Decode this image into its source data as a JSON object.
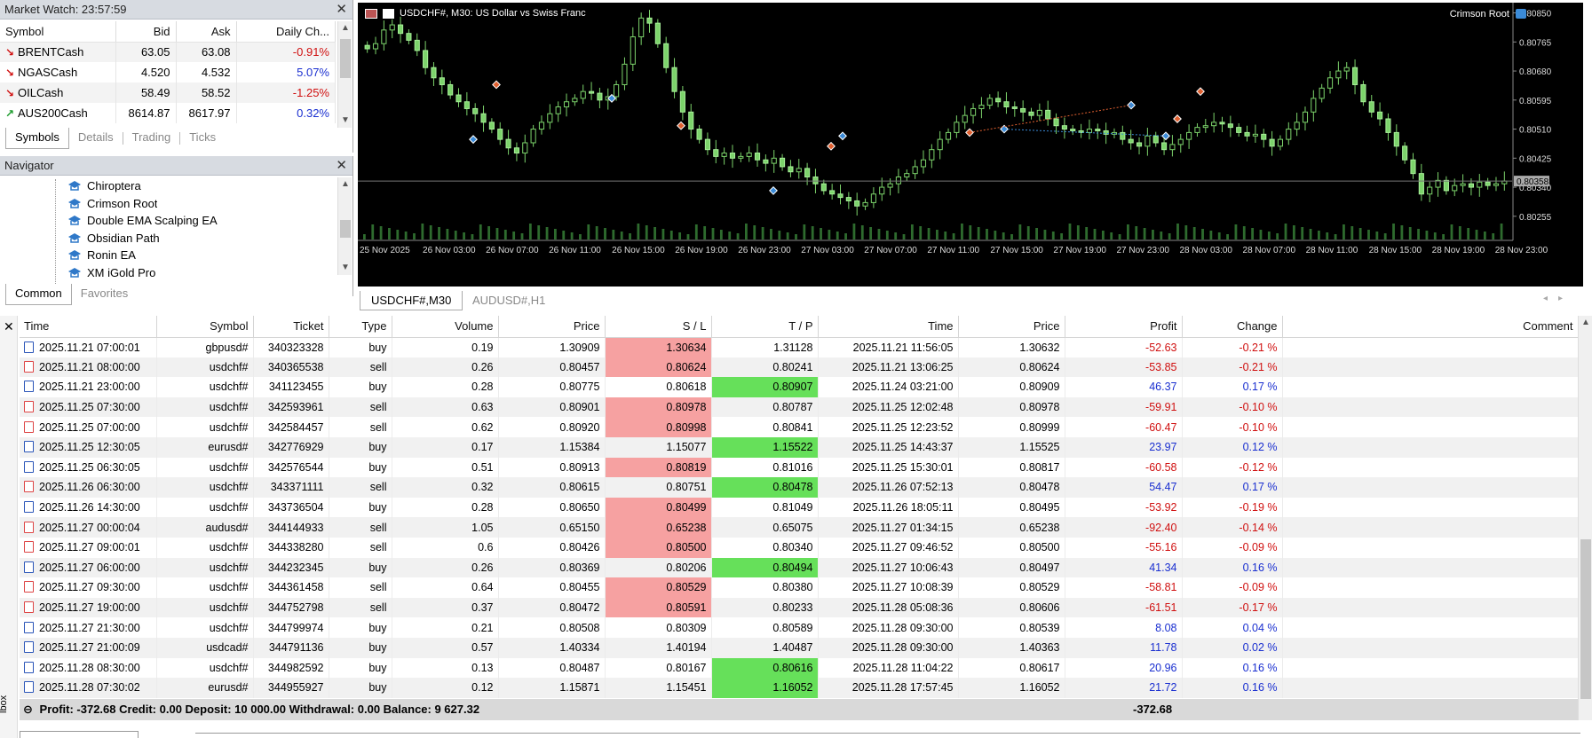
{
  "market_watch": {
    "title": "Market Watch: 23:57:59",
    "columns": [
      "Symbol",
      "Bid",
      "Ask",
      "Daily Ch..."
    ],
    "rows": [
      {
        "symbol": "BRENTCash",
        "bid": "63.05",
        "ask": "63.08",
        "change": "-0.91%",
        "dir": "down"
      },
      {
        "symbol": "NGASCash",
        "bid": "4.520",
        "ask": "4.532",
        "change": "5.07%",
        "dir": "down"
      },
      {
        "symbol": "OILCash",
        "bid": "58.49",
        "ask": "58.52",
        "change": "-1.25%",
        "dir": "down"
      },
      {
        "symbol": "AUS200Cash",
        "bid": "8614.87",
        "ask": "8617.97",
        "change": "0.32%",
        "dir": "up"
      }
    ],
    "tabs": [
      "Symbols",
      "Details",
      "Trading",
      "Ticks"
    ]
  },
  "navigator": {
    "title": "Navigator",
    "items": [
      "Chiroptera",
      "Crimson Root",
      "Double EMA Scalping EA",
      "Obsidian Path",
      "Ronin EA",
      "XM iGold Pro"
    ],
    "tabs": [
      "Common",
      "Favorites"
    ]
  },
  "chart": {
    "title": "USDCHF#, M30:  US Dollar vs Swiss Franc",
    "ea_label": "Crimson Root",
    "current_price": "0.80358",
    "price_ticks": [
      "0.80850",
      "0.80765",
      "0.80680",
      "0.80595",
      "0.80510",
      "0.80425",
      "0.80340",
      "0.80255"
    ],
    "time_ticks": [
      "25 Nov 2025",
      "26 Nov 03:00",
      "26 Nov 07:00",
      "26 Nov 11:00",
      "26 Nov 15:00",
      "26 Nov 19:00",
      "26 Nov 23:00",
      "27 Nov 03:00",
      "27 Nov 07:00",
      "27 Nov 11:00",
      "27 Nov 15:00",
      "27 Nov 19:00",
      "27 Nov 23:00",
      "28 Nov 03:00",
      "28 Nov 07:00",
      "28 Nov 11:00",
      "28 Nov 15:00",
      "28 Nov 19:00",
      "28 Nov 23:00"
    ],
    "tabs": [
      "USDCHF#,M30",
      "AUDUSD#,H1"
    ],
    "colors": {
      "bg": "#000000",
      "bull": "#7cd36b",
      "bear": "#e8ffe0",
      "grid": "#2a2a2a"
    },
    "closes": [
      0.80745,
      0.8076,
      0.808,
      0.80815,
      0.8079,
      0.8077,
      0.8074,
      0.8069,
      0.8066,
      0.8064,
      0.8061,
      0.8059,
      0.8057,
      0.80555,
      0.8053,
      0.8051,
      0.8048,
      0.80455,
      0.8044,
      0.8047,
      0.8051,
      0.8053,
      0.80555,
      0.80575,
      0.8059,
      0.806,
      0.8062,
      0.80615,
      0.80595,
      0.80605,
      0.8064,
      0.807,
      0.8078,
      0.80835,
      0.8082,
      0.8076,
      0.8069,
      0.8062,
      0.8056,
      0.8051,
      0.8048,
      0.8045,
      0.8043,
      0.8044,
      0.80425,
      0.8043,
      0.8044,
      0.8042,
      0.8041,
      0.80425,
      0.804,
      0.80385,
      0.80395,
      0.8037,
      0.8035,
      0.8033,
      0.8032,
      0.8031,
      0.803,
      0.80285,
      0.80295,
      0.8032,
      0.8034,
      0.8035,
      0.8037,
      0.8038,
      0.804,
      0.8042,
      0.8045,
      0.8048,
      0.805,
      0.8053,
      0.8055,
      0.8057,
      0.8058,
      0.806,
      0.8059,
      0.80575,
      0.8057,
      0.8056,
      0.8055,
      0.80565,
      0.8054,
      0.8052,
      0.8051,
      0.80505,
      0.805,
      0.8051,
      0.80505,
      0.80495,
      0.805,
      0.8048,
      0.8047,
      0.8046,
      0.8049,
      0.8047,
      0.8045,
      0.80465,
      0.8048,
      0.805,
      0.80515,
      0.8052,
      0.8053,
      0.80525,
      0.80515,
      0.805,
      0.8049,
      0.80495,
      0.8048,
      0.8046,
      0.8048,
      0.8051,
      0.8053,
      0.8056,
      0.806,
      0.8063,
      0.8066,
      0.8068,
      0.8069,
      0.8064,
      0.8059,
      0.8056,
      0.8054,
      0.805,
      0.8046,
      0.8042,
      0.8038,
      0.8032,
      0.8034,
      0.8036,
      0.8033,
      0.80345,
      0.8035,
      0.8034,
      0.80355,
      0.80345,
      0.8035,
      0.80358
    ]
  },
  "trades": {
    "columns": [
      "Time",
      "Symbol",
      "Ticket",
      "Type",
      "Volume",
      "Price",
      "S / L",
      "T / P",
      "Time",
      "Price",
      "Profit",
      "Change",
      "Comment"
    ],
    "rows": [
      {
        "open_time": "2025.11.21 07:00:01",
        "symbol": "gbpusd#",
        "ticket": "340323328",
        "type": "buy",
        "volume": "0.19",
        "price": "1.30909",
        "sl": "1.30634",
        "tp": "1.31128",
        "close_time": "2025.11.21 11:56:05",
        "close_price": "1.30632",
        "profit": "-52.63",
        "change": "-0.21 %",
        "hit": "sl"
      },
      {
        "open_time": "2025.11.21 08:00:00",
        "symbol": "usdchf#",
        "ticket": "340365538",
        "type": "sell",
        "volume": "0.26",
        "price": "0.80457",
        "sl": "0.80624",
        "tp": "0.80241",
        "close_time": "2025.11.21 13:06:25",
        "close_price": "0.80624",
        "profit": "-53.85",
        "change": "-0.21 %",
        "hit": "sl"
      },
      {
        "open_time": "2025.11.21 23:00:00",
        "symbol": "usdchf#",
        "ticket": "341123455",
        "type": "buy",
        "volume": "0.28",
        "price": "0.80775",
        "sl": "0.80618",
        "tp": "0.80907",
        "close_time": "2025.11.24 03:21:00",
        "close_price": "0.80909",
        "profit": "46.37",
        "change": "0.17 %",
        "hit": "tp"
      },
      {
        "open_time": "2025.11.25 07:30:00",
        "symbol": "usdchf#",
        "ticket": "342593961",
        "type": "sell",
        "volume": "0.63",
        "price": "0.80901",
        "sl": "0.80978",
        "tp": "0.80787",
        "close_time": "2025.11.25 12:02:48",
        "close_price": "0.80978",
        "profit": "-59.91",
        "change": "-0.10 %",
        "hit": "sl"
      },
      {
        "open_time": "2025.11.25 07:00:00",
        "symbol": "usdchf#",
        "ticket": "342584457",
        "type": "sell",
        "volume": "0.62",
        "price": "0.80920",
        "sl": "0.80998",
        "tp": "0.80841",
        "close_time": "2025.11.25 12:23:52",
        "close_price": "0.80999",
        "profit": "-60.47",
        "change": "-0.10 %",
        "hit": "sl"
      },
      {
        "open_time": "2025.11.25 12:30:05",
        "symbol": "eurusd#",
        "ticket": "342776929",
        "type": "buy",
        "volume": "0.17",
        "price": "1.15384",
        "sl": "1.15077",
        "tp": "1.15522",
        "close_time": "2025.11.25 14:43:37",
        "close_price": "1.15525",
        "profit": "23.97",
        "change": "0.12 %",
        "hit": "tp"
      },
      {
        "open_time": "2025.11.25 06:30:05",
        "symbol": "usdchf#",
        "ticket": "342576544",
        "type": "buy",
        "volume": "0.51",
        "price": "0.80913",
        "sl": "0.80819",
        "tp": "0.81016",
        "close_time": "2025.11.25 15:30:01",
        "close_price": "0.80817",
        "profit": "-60.58",
        "change": "-0.12 %",
        "hit": "sl"
      },
      {
        "open_time": "2025.11.26 06:30:00",
        "symbol": "usdchf#",
        "ticket": "343371111",
        "type": "sell",
        "volume": "0.32",
        "price": "0.80615",
        "sl": "0.80751",
        "tp": "0.80478",
        "close_time": "2025.11.26 07:52:13",
        "close_price": "0.80478",
        "profit": "54.47",
        "change": "0.17 %",
        "hit": "tp"
      },
      {
        "open_time": "2025.11.26 14:30:00",
        "symbol": "usdchf#",
        "ticket": "343736504",
        "type": "buy",
        "volume": "0.28",
        "price": "0.80650",
        "sl": "0.80499",
        "tp": "0.81049",
        "close_time": "2025.11.26 18:05:11",
        "close_price": "0.80495",
        "profit": "-53.92",
        "change": "-0.19 %",
        "hit": "sl"
      },
      {
        "open_time": "2025.11.27 00:00:04",
        "symbol": "audusd#",
        "ticket": "344144933",
        "type": "sell",
        "volume": "1.05",
        "price": "0.65150",
        "sl": "0.65238",
        "tp": "0.65075",
        "close_time": "2025.11.27 01:34:15",
        "close_price": "0.65238",
        "profit": "-92.40",
        "change": "-0.14 %",
        "hit": "sl"
      },
      {
        "open_time": "2025.11.27 09:00:01",
        "symbol": "usdchf#",
        "ticket": "344338280",
        "type": "sell",
        "volume": "0.6",
        "price": "0.80426",
        "sl": "0.80500",
        "tp": "0.80340",
        "close_time": "2025.11.27 09:46:52",
        "close_price": "0.80500",
        "profit": "-55.16",
        "change": "-0.09 %",
        "hit": "sl"
      },
      {
        "open_time": "2025.11.27 06:00:00",
        "symbol": "usdchf#",
        "ticket": "344232345",
        "type": "buy",
        "volume": "0.26",
        "price": "0.80369",
        "sl": "0.80206",
        "tp": "0.80494",
        "close_time": "2025.11.27 10:06:43",
        "close_price": "0.80497",
        "profit": "41.34",
        "change": "0.16 %",
        "hit": "tp"
      },
      {
        "open_time": "2025.11.27 09:30:00",
        "symbol": "usdchf#",
        "ticket": "344361458",
        "type": "sell",
        "volume": "0.64",
        "price": "0.80455",
        "sl": "0.80529",
        "tp": "0.80380",
        "close_time": "2025.11.27 10:08:39",
        "close_price": "0.80529",
        "profit": "-58.81",
        "change": "-0.09 %",
        "hit": "sl"
      },
      {
        "open_time": "2025.11.27 19:00:00",
        "symbol": "usdchf#",
        "ticket": "344752798",
        "type": "sell",
        "volume": "0.37",
        "price": "0.80472",
        "sl": "0.80591",
        "tp": "0.80233",
        "close_time": "2025.11.28 05:08:36",
        "close_price": "0.80606",
        "profit": "-61.51",
        "change": "-0.17 %",
        "hit": "sl"
      },
      {
        "open_time": "2025.11.27 21:30:00",
        "symbol": "usdchf#",
        "ticket": "344799974",
        "type": "buy",
        "volume": "0.21",
        "price": "0.80508",
        "sl": "0.80309",
        "tp": "0.80589",
        "close_time": "2025.11.28 09:30:00",
        "close_price": "0.80539",
        "profit": "8.08",
        "change": "0.04 %",
        "hit": "none"
      },
      {
        "open_time": "2025.11.27 21:00:09",
        "symbol": "usdcad#",
        "ticket": "344791136",
        "type": "buy",
        "volume": "0.57",
        "price": "1.40334",
        "sl": "1.40194",
        "tp": "1.40487",
        "close_time": "2025.11.28 09:30:00",
        "close_price": "1.40363",
        "profit": "11.78",
        "change": "0.02 %",
        "hit": "none"
      },
      {
        "open_time": "2025.11.28 08:30:00",
        "symbol": "usdchf#",
        "ticket": "344982592",
        "type": "buy",
        "volume": "0.13",
        "price": "0.80487",
        "sl": "0.80167",
        "tp": "0.80616",
        "close_time": "2025.11.28 11:04:22",
        "close_price": "0.80617",
        "profit": "20.96",
        "change": "0.16 %",
        "hit": "tp"
      },
      {
        "open_time": "2025.11.28 07:30:02",
        "symbol": "eurusd#",
        "ticket": "344955927",
        "type": "buy",
        "volume": "0.12",
        "price": "1.15871",
        "sl": "1.15451",
        "tp": "1.16052",
        "close_time": "2025.11.28 17:57:45",
        "close_price": "1.16052",
        "profit": "21.72",
        "change": "0.16 %",
        "hit": "tp"
      }
    ],
    "summary": "Profit: -372.68  Credit: 0.00  Deposit: 10 000.00  Withdrawal: 0.00  Balance: 9 627.32",
    "summary_total": "-372.68"
  },
  "side_label": "lbox"
}
